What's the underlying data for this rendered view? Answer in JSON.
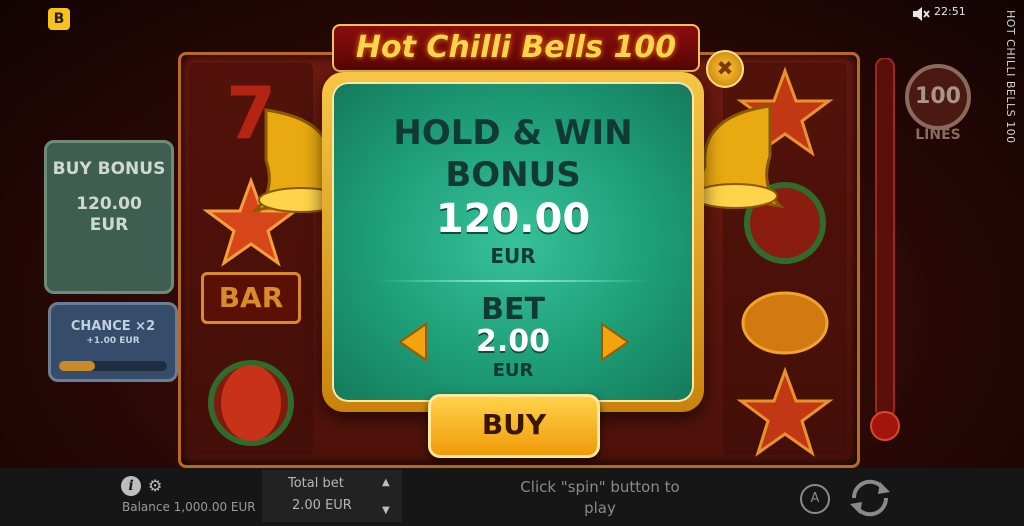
{
  "top": {
    "brand_letter": "B",
    "sound_icon": "speaker-muted-icon",
    "clock": "22:51",
    "side_title": "HOT CHILLI BELLS 100"
  },
  "logo": {
    "text": "Hot Chilli Bells 100"
  },
  "left_panels": {
    "buy_bonus": {
      "title": "BUY BONUS",
      "amount": "120.00",
      "currency": "EUR"
    },
    "chance": {
      "title": "CHANCE ×2",
      "sub": "+1.00 EUR"
    }
  },
  "right_panels": {
    "lines_value": "100",
    "lines_label": "LINES"
  },
  "reels": {
    "symbols": [
      "7",
      "star",
      "bar",
      "watermelon",
      "bell",
      "watermelon",
      "lemon",
      "star"
    ],
    "bar_label": "BAR"
  },
  "dialog": {
    "title_line1": "HOLD & WIN",
    "title_line2": "BONUS",
    "price": "120.00",
    "price_currency": "EUR",
    "bet_label": "BET",
    "bet_value": "2.00",
    "bet_currency": "EUR",
    "buy_label": "BUY",
    "close_glyph": "✖"
  },
  "bottom": {
    "balance": "Balance 1,000.00 EUR",
    "total_bet_label": "Total bet",
    "total_bet_value": "2.00 EUR",
    "hint": "Click \"spin\" button to play",
    "auto_label": "A"
  },
  "colors": {
    "dialog_green": "#1c9a73",
    "gold": "#f7c646",
    "dark_red": "#5a1208"
  }
}
